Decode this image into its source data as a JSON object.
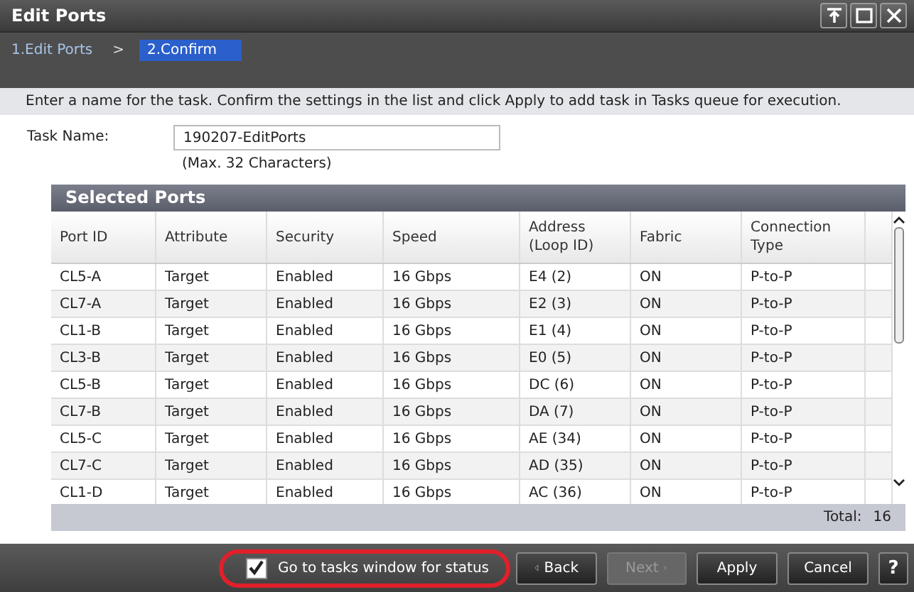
{
  "window": {
    "title": "Edit Ports"
  },
  "steps": [
    {
      "label": "1.Edit Ports",
      "selected": false
    },
    {
      "label": "2.Confirm",
      "selected": true
    }
  ],
  "step_separator": ">",
  "instruction": "Enter a name for the task. Confirm the settings in the list and click Apply to add task in Tasks queue for execution.",
  "task_name": {
    "label": "Task Name:",
    "value": "190207-EditPorts",
    "hint": "(Max. 32 Characters)"
  },
  "table": {
    "title": "Selected Ports",
    "columns": [
      "Port ID",
      "Attribute",
      "Security",
      "Speed",
      "Address\n(Loop ID)",
      "Fabric",
      "Connection\nType"
    ],
    "rows": [
      [
        "CL5-A",
        "Target",
        "Enabled",
        "16 Gbps",
        "E4 (2)",
        "ON",
        "P-to-P"
      ],
      [
        "CL7-A",
        "Target",
        "Enabled",
        "16 Gbps",
        "E2 (3)",
        "ON",
        "P-to-P"
      ],
      [
        "CL1-B",
        "Target",
        "Enabled",
        "16 Gbps",
        "E1 (4)",
        "ON",
        "P-to-P"
      ],
      [
        "CL3-B",
        "Target",
        "Enabled",
        "16 Gbps",
        "E0 (5)",
        "ON",
        "P-to-P"
      ],
      [
        "CL5-B",
        "Target",
        "Enabled",
        "16 Gbps",
        "DC (6)",
        "ON",
        "P-to-P"
      ],
      [
        "CL7-B",
        "Target",
        "Enabled",
        "16 Gbps",
        "DA (7)",
        "ON",
        "P-to-P"
      ],
      [
        "CL5-C",
        "Target",
        "Enabled",
        "16 Gbps",
        "AE (34)",
        "ON",
        "P-to-P"
      ],
      [
        "CL7-C",
        "Target",
        "Enabled",
        "16 Gbps",
        "AD (35)",
        "ON",
        "P-to-P"
      ],
      [
        "CL1-D",
        "Target",
        "Enabled",
        "16 Gbps",
        "AC (36)",
        "ON",
        "P-to-P"
      ]
    ],
    "total_label": "Total:",
    "total_value": "16"
  },
  "go_to_tasks": {
    "label": "Go to tasks window for status",
    "checked": true,
    "highlighted": true
  },
  "buttons": [
    {
      "label": "Back",
      "kind": "back",
      "disabled": false
    },
    {
      "label": "Next",
      "kind": "next",
      "disabled": true
    },
    {
      "label": "Apply",
      "kind": "plain",
      "disabled": false
    },
    {
      "label": "Cancel",
      "kind": "plain",
      "disabled": false
    },
    {
      "label": "?",
      "kind": "help",
      "disabled": false
    }
  ]
}
